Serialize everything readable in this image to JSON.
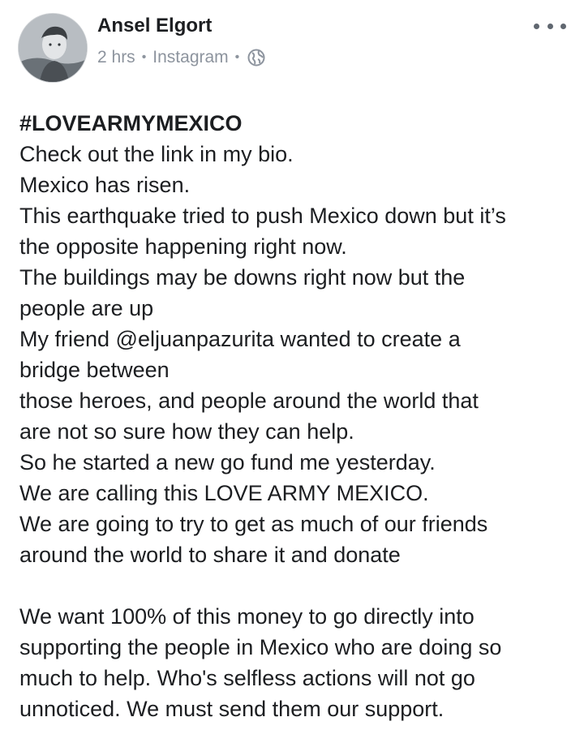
{
  "post": {
    "author": "Ansel Elgort",
    "time": "2 hrs",
    "source": "Instagram",
    "privacy_icon": "globe-icon",
    "more_icon": "more-options-icon",
    "hashtag": "#LOVEARMYMEXICO",
    "lines": [
      "Check out the link in my bio.",
      "Mexico has risen.",
      "This earthquake tried to push Mexico down but it’s",
      "the opposite happening right now.",
      "The buildings may be downs right now but the",
      "people are up",
      "My friend @eljuanpazurita wanted to create a",
      "bridge between",
      "those heroes, and people around the world that",
      "are not so sure how they can help.",
      "So he started a new go fund me yesterday.",
      "We are calling this LOVE ARMY MEXICO.",
      "We are going to try to get as much of our friends",
      "around the world to share it and donate"
    ],
    "lines2": [
      "We want 100% of this money to go directly into",
      "supporting the people in Mexico who are doing so",
      "much to help. Who's selfless actions will not go",
      "unnoticed. We must send them our support."
    ]
  }
}
